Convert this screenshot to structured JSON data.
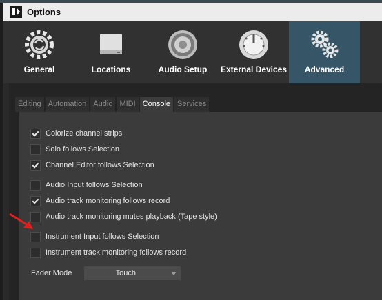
{
  "window": {
    "title": "Options"
  },
  "categories": [
    {
      "label": "General",
      "icon": "gear-refresh-icon",
      "active": false
    },
    {
      "label": "Locations",
      "icon": "drive-icon",
      "active": false
    },
    {
      "label": "Audio Setup",
      "icon": "speaker-icon",
      "active": false
    },
    {
      "label": "External Devices",
      "icon": "knob-icon",
      "active": false
    },
    {
      "label": "Advanced",
      "icon": "gears-icon",
      "active": true
    }
  ],
  "tabs": [
    {
      "label": "Editing",
      "active": false
    },
    {
      "label": "Automation",
      "active": false
    },
    {
      "label": "Audio",
      "active": false
    },
    {
      "label": "MIDI",
      "active": false
    },
    {
      "label": "Console",
      "active": true
    },
    {
      "label": "Services",
      "active": false
    }
  ],
  "options": [
    {
      "label": "Colorize channel strips",
      "checked": true
    },
    {
      "label": "Solo follows Selection",
      "checked": false
    },
    {
      "label": "Channel Editor follows Selection",
      "checked": true
    },
    {
      "label": "Audio Input follows Selection",
      "checked": false
    },
    {
      "label": "Audio track monitoring follows record",
      "checked": true
    },
    {
      "label": "Audio track monitoring mutes playback (Tape style)",
      "checked": false
    },
    {
      "label": "Instrument Input follows Selection",
      "checked": false
    },
    {
      "label": "Instrument track monitoring follows record",
      "checked": false
    }
  ],
  "fader_mode": {
    "label": "Fader Mode",
    "value": "Touch"
  },
  "colors": {
    "accent_active": "#365567",
    "annotation_arrow": "#e02020"
  }
}
